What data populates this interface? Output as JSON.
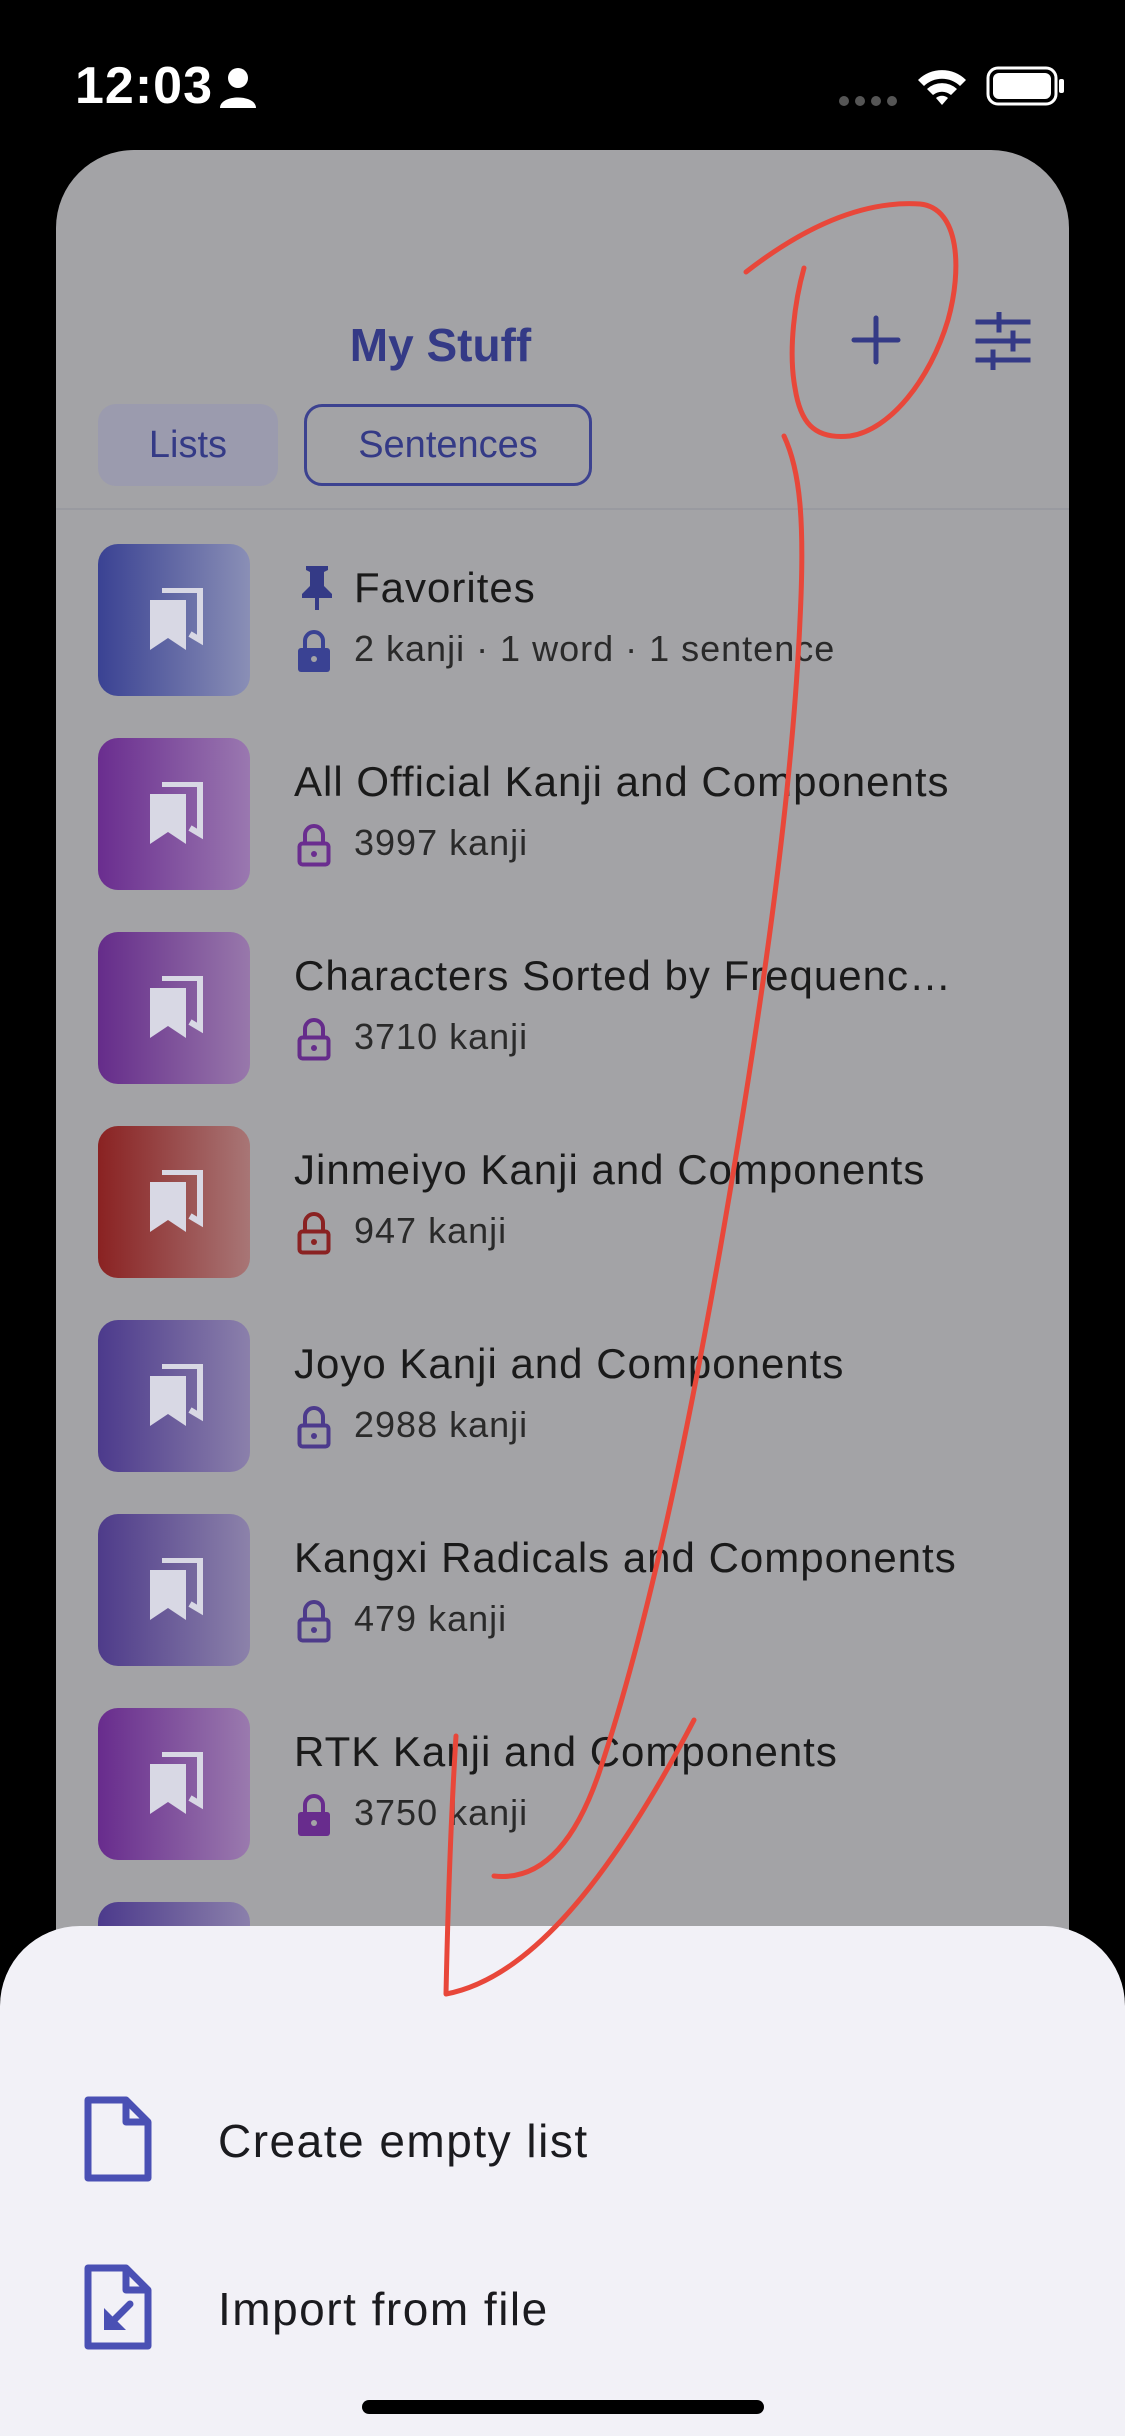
{
  "status_bar": {
    "time": "12:03"
  },
  "header": {
    "title": "My Stuff"
  },
  "tabs": [
    {
      "label": "Lists"
    },
    {
      "label": "Sentences"
    }
  ],
  "lists": [
    {
      "title": "Favorites",
      "subtitle": "2 kanji · 1 word · 1 sentence",
      "color_from": "#3a4293",
      "color_to": "#8a8fb6",
      "pinned": true
    },
    {
      "title": "All Official Kanji and Components",
      "subtitle": "3997 kanji",
      "color_from": "#6a2d8f",
      "color_to": "#9a78b0"
    },
    {
      "title": "Characters Sorted by Frequenc…",
      "subtitle": "3710 kanji",
      "color_from": "#652c8a",
      "color_to": "#9878ab"
    },
    {
      "title": "Jinmeiyo Kanji and Components",
      "subtitle": "947 kanji",
      "color_from": "#8a2222",
      "color_to": "#a87676"
    },
    {
      "title": "Joyo Kanji and Components",
      "subtitle": "2988 kanji",
      "color_from": "#4c3a8c",
      "color_to": "#8b80ab"
    },
    {
      "title": "Kangxi Radicals and Components",
      "subtitle": "479 kanji",
      "color_from": "#4e3b8a",
      "color_to": "#8c82aa"
    },
    {
      "title": "RTK Kanji and Components",
      "subtitle": "3750 kanji",
      "color_from": "#682c8d",
      "color_to": "#9a7aae"
    }
  ],
  "sheet": {
    "items": [
      {
        "label": "Create empty list",
        "icon": "file-icon"
      },
      {
        "label": "Import from file",
        "icon": "file-import-icon"
      }
    ]
  },
  "accent_color": "#343a86",
  "annotation_color": "#e8473a"
}
